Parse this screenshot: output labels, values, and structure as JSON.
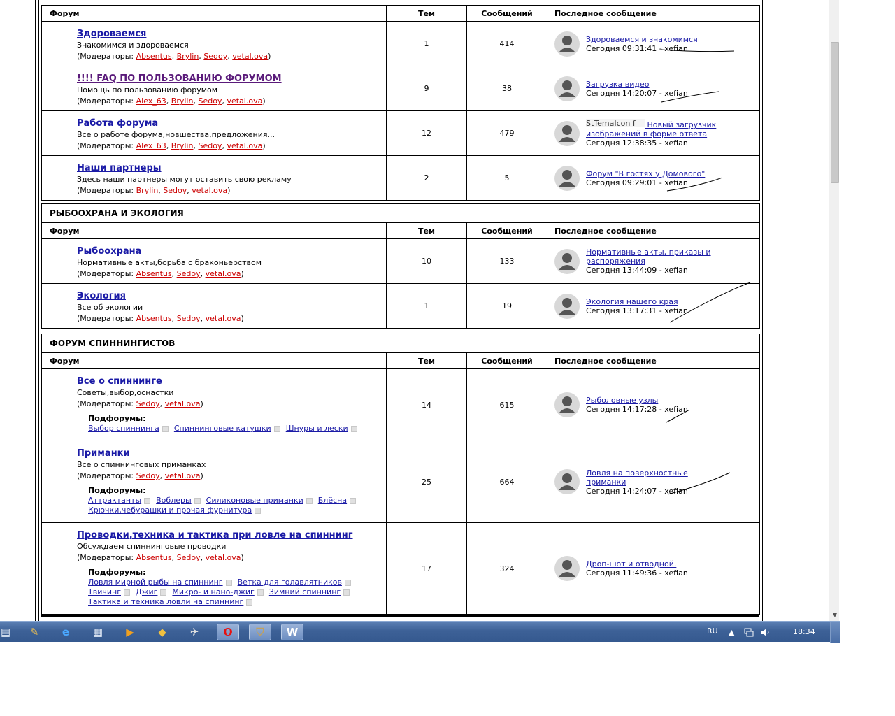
{
  "columns": {
    "forum": "Форум",
    "topics": "Тем",
    "posts": "Сообщений",
    "last": "Последное сообщение"
  },
  "moderators_label": "(Модераторы:",
  "subforums_label": "Подфорумы:",
  "categories": [
    {
      "title": "",
      "forums": [
        {
          "name": "Здороваемся",
          "desc": "Знакомимся и здороваемся",
          "mods": [
            "Absentus",
            "Brylin",
            "Sedoy",
            "vetal.ova"
          ],
          "topics": "1",
          "posts": "414",
          "last_topic": "Здороваемся и знакомимся",
          "last_time": "Сегодня 09:31:41 - xefian"
        },
        {
          "name": "!!!! FAQ ПО ПОЛЬЗОВАНИЮ ФОРУМОМ",
          "desc": "Помощь по пользованию форумом",
          "mods": [
            "Alex_63",
            "Brylin",
            "Sedoy",
            "vetal.ova"
          ],
          "topics": "9",
          "posts": "38",
          "last_topic": "Загрузка видео",
          "last_time": "Сегодня 14:20:07 - xefian"
        },
        {
          "name": "Работа форума",
          "desc": "Все о работе форума,новшества,предложения...",
          "mods": [
            "Alex_63",
            "Brylin",
            "Sedoy",
            "vetal.ova"
          ],
          "topics": "12",
          "posts": "479",
          "last_icon_alt": "StTemaIcon f",
          "last_topic": "Новый загрузчик изображений в форме ответа",
          "last_time": "Сегодня 12:38:35 - xefian"
        },
        {
          "name": "Наши партнеры",
          "desc": "Здесь наши партнеры могут оставить свою рекламу",
          "mods": [
            "Brylin",
            "Sedoy",
            "vetal.ova"
          ],
          "topics": "2",
          "posts": "5",
          "last_topic": "Форум \"В гостях у Домового\"",
          "last_time": "Сегодня 09:29:01 - xefian"
        }
      ]
    },
    {
      "title": "РЫБООХРАНА И ЭКОЛОГИЯ",
      "forums": [
        {
          "name": "Рыбоохрана",
          "desc": "Нормативные акты,борьба с браконьерством",
          "mods": [
            "Absentus",
            "Sedoy",
            "vetal.ova"
          ],
          "topics": "10",
          "posts": "133",
          "last_topic": "Нормативные акты, приказы и распоряжения",
          "last_time": "Сегодня 13:44:09 - xefian"
        },
        {
          "name": "Экология",
          "desc": "Все об экологии",
          "mods": [
            "Absentus",
            "Sedoy",
            "vetal.ova"
          ],
          "topics": "1",
          "posts": "19",
          "last_topic": "Экология нашего края",
          "last_time": "Сегодня 13:17:31 - xefian"
        }
      ]
    },
    {
      "title": "ФОРУМ СПИННИНГИСТОВ",
      "forums": [
        {
          "name": "Все о спиннинге",
          "desc": "Советы,выбор,оснастки",
          "mods": [
            "Sedoy",
            "vetal.ova"
          ],
          "subs": [
            "Выбор спиннинга",
            "Спиннинговые катушки",
            "Шнуры и лески"
          ],
          "topics": "14",
          "posts": "615",
          "last_topic": "Рыболовные узлы",
          "last_time": "Сегодня 14:17:28 - xefian"
        },
        {
          "name": "Приманки",
          "desc": "Все о спиннинговых приманках",
          "mods": [
            "Sedoy",
            "vetal.ova"
          ],
          "subs": [
            "Аттрактанты",
            "Воблеры",
            "Силиконовые приманки",
            "Блёсна",
            "Крючки,чебурашки и прочая фурнитура"
          ],
          "topics": "25",
          "posts": "664",
          "last_topic": "Ловля на поверхностные приманки",
          "last_time": "Сегодня 14:24:07 - xefian"
        },
        {
          "name": "Проводки,техника и тактика при ловле на спиннинг",
          "desc": "Обсуждаем спиннинговые проводки",
          "mods": [
            "Absentus",
            "Sedoy",
            "vetal.ova"
          ],
          "subs": [
            "Ловля мирной рыбы на спиннинг",
            "Ветка для голавлятников",
            "Твичинг",
            "Джиг",
            "Микро- и нано-джиг",
            "Зимний спиннинг",
            "Тактика и техника ловли на спиннинг"
          ],
          "topics": "17",
          "posts": "324",
          "last_topic": "Дроп-шот и отводной.",
          "last_time": "Сегодня 11:49:36 - xefian"
        }
      ]
    }
  ],
  "taskbar": {
    "apps": [
      "calendar-app-icon",
      "paint-app-icon",
      "internet-explorer-icon",
      "chart-app-icon",
      "media-player-icon",
      "notes-app-icon",
      "tools-app-icon",
      "opera-icon",
      "shield-app-icon",
      "word-app-icon"
    ],
    "language": "RU",
    "clock": "18:34"
  }
}
